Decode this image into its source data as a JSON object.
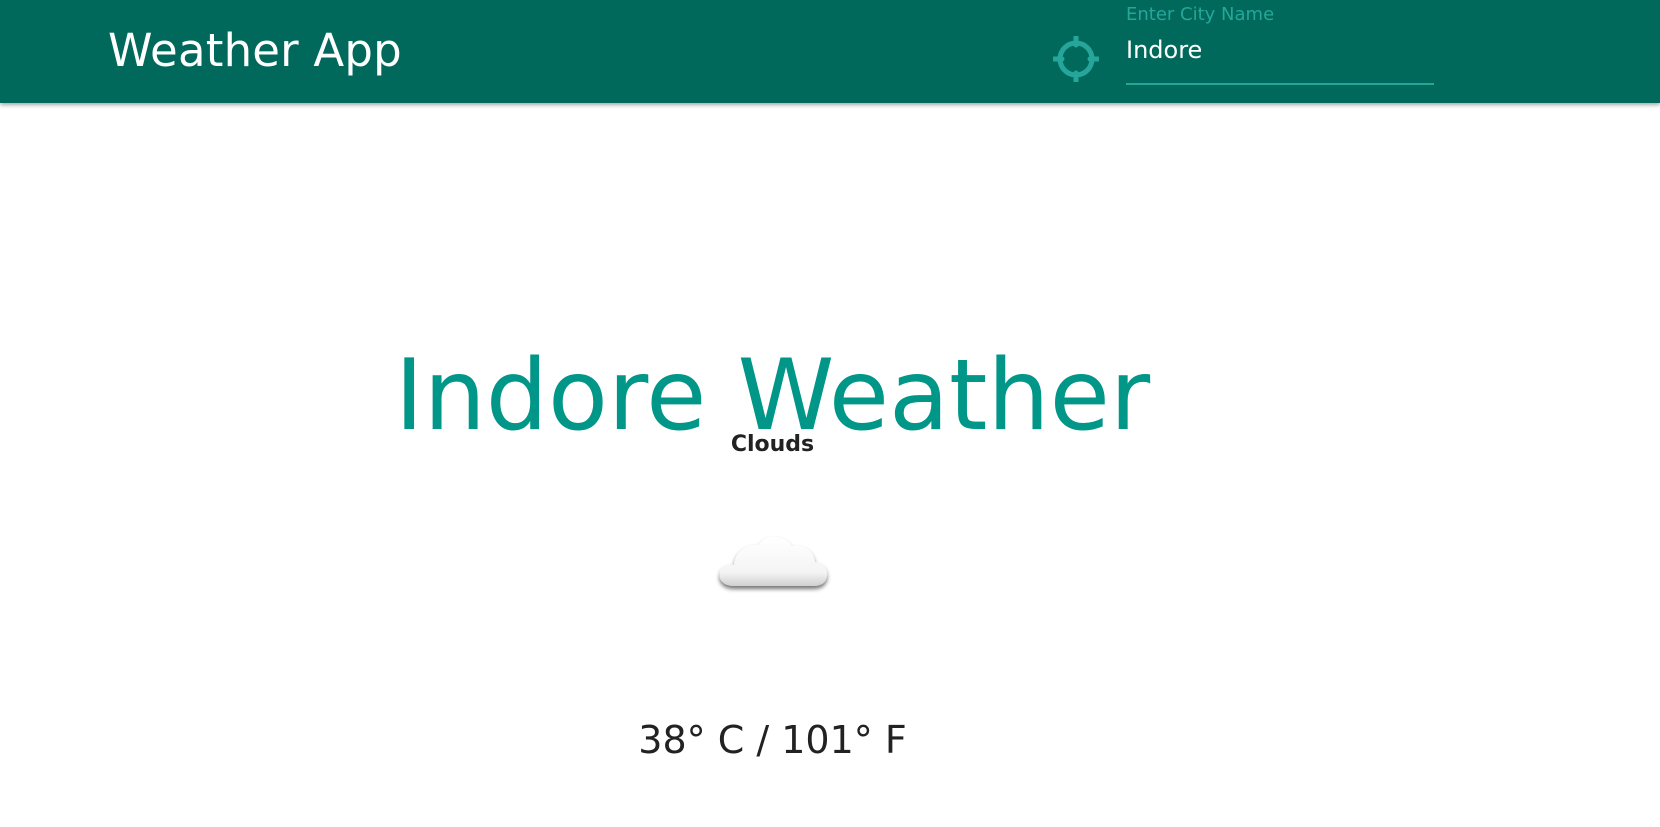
{
  "header": {
    "title": "Weather App",
    "location_icon": "crosshair-gps-icon",
    "search": {
      "label": "Enter City Name",
      "value": "Indore"
    }
  },
  "weather": {
    "title": "Indore Weather",
    "description": "Clouds",
    "icon": "cloud-icon",
    "temperature": "38° C / 101° F"
  },
  "colors": {
    "app_bar": "#00695c",
    "accent": "#26a69a",
    "title_teal": "#009688"
  }
}
